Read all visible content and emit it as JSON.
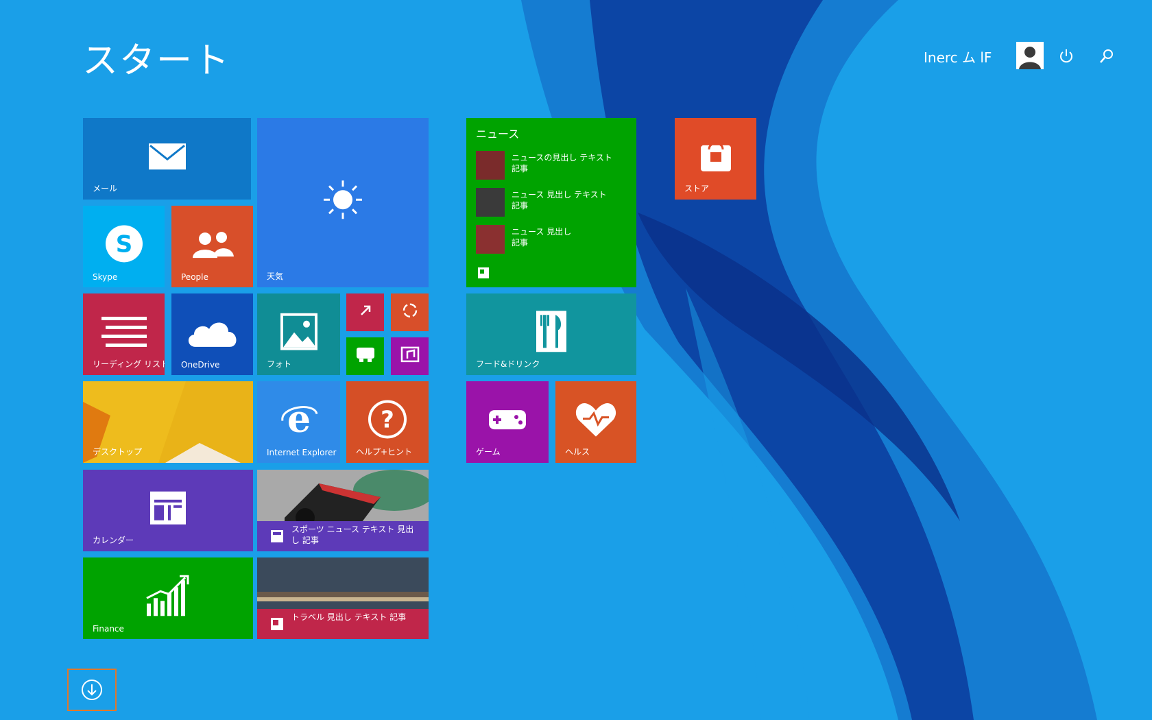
{
  "header": {
    "title": "スタート",
    "user_name": "Inerc ム lF"
  },
  "colors": {
    "background": "#1a9fe8",
    "mail": "#0f78c8",
    "weather": "#2b7ae6",
    "skype": "#00aff0",
    "people": "#d84f2a",
    "reading": "#c0264a",
    "onedrive": "#0f4fb8",
    "photos": "#108d95",
    "news": "#00a300",
    "store": "#e04b28",
    "food": "#11959e",
    "games": "#9a13a9",
    "health": "#d85325",
    "help": "#d54f26",
    "ie": "#2f8be8",
    "calendar": "#5d3ab8",
    "finance": "#00a300",
    "sport": "#c0264a",
    "apps_button_border": "#e0782b"
  },
  "tiles": {
    "mail": {
      "label": "メール"
    },
    "weather": {
      "label": "天気"
    },
    "skype": {
      "label": "Skype"
    },
    "people": {
      "label": "People"
    },
    "reading": {
      "label": "リーディング リスト"
    },
    "onedrive": {
      "label": "OneDrive"
    },
    "photos": {
      "label": "フォト"
    },
    "desktop": {
      "label": "デスクトップ"
    },
    "ie": {
      "label": "Internet Explorer"
    },
    "help": {
      "label": "ヘルプ+ヒント"
    },
    "calendar": {
      "label": "カレンダー"
    },
    "finance": {
      "label": "Finance"
    },
    "news": {
      "header": "ニュース",
      "items": [
        {
          "text": "ニュースの見出し テキスト",
          "sub": "記事"
        },
        {
          "text": "ニュース 見出し テキスト",
          "sub": "記事"
        },
        {
          "text": "ニュース 見出し",
          "sub": "記事"
        }
      ]
    },
    "store": {
      "label": "ストア"
    },
    "food": {
      "label": "フード&ドリンク"
    },
    "games": {
      "label": "ゲーム"
    },
    "health": {
      "label": "ヘルス"
    },
    "sport_photo": {
      "caption": "スポーツ ニュース テキスト 見出し 記事"
    },
    "travel_photo": {
      "caption": "トラベル 見出し テキスト 記事"
    }
  },
  "icons": {
    "mail": "envelope-icon",
    "weather": "sun-icon",
    "skype": "skype-icon",
    "people": "people-icon",
    "reading": "reading-list-icon",
    "onedrive": "cloud-icon",
    "photos": "photo-icon",
    "ie": "internet-explorer-icon",
    "help": "question-icon",
    "calendar": "calendar-icon",
    "finance": "chart-icon",
    "store": "shopping-bag-icon",
    "food": "fork-knife-icon",
    "games": "gamepad-icon",
    "health": "heart-icon",
    "power": "power-icon",
    "search": "search-icon",
    "apps": "arrow-down-circle-icon"
  }
}
